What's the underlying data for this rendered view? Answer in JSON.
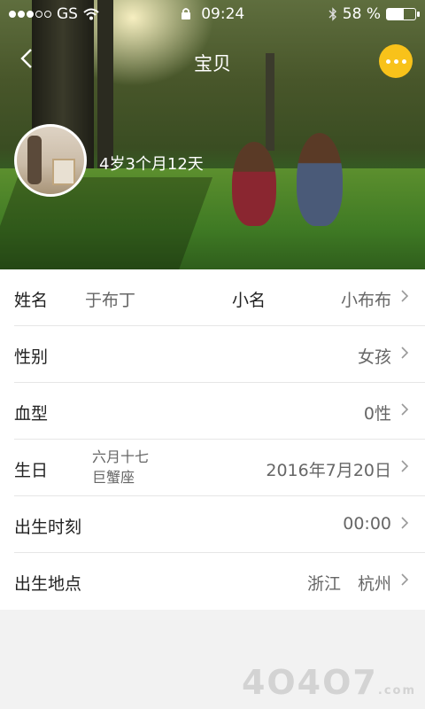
{
  "status_bar": {
    "carrier": "GS",
    "time": "09:24",
    "battery": "58 %",
    "battery_level": 0.58,
    "icons": [
      "signal-dots-icon",
      "wifi-icon",
      "lock-icon",
      "bluetooth-icon",
      "battery-icon"
    ]
  },
  "nav": {
    "title": "宝贝",
    "back_icon": "chevron-left-icon",
    "more_icon": "more-dots-icon",
    "accent": "#f8c21a"
  },
  "profile": {
    "age": "4岁3个月12天"
  },
  "fields": {
    "name": {
      "label": "姓名",
      "value": "于布丁"
    },
    "nickname": {
      "label": "小名",
      "value": "小布布"
    },
    "gender": {
      "label": "性别",
      "value": "女孩"
    },
    "blood": {
      "label": "血型",
      "value": "0性"
    },
    "birthday": {
      "label": "生日",
      "lunar": "六月十七",
      "zodiac": "巨蟹座",
      "value": "2016年7月20日"
    },
    "birth_time": {
      "label": "出生时刻",
      "value": "00:00"
    },
    "birth_place": {
      "label": "出生地点",
      "value": "浙江　杭州"
    }
  },
  "watermark": {
    "text": "4O4O7",
    "suffix": ".com"
  }
}
